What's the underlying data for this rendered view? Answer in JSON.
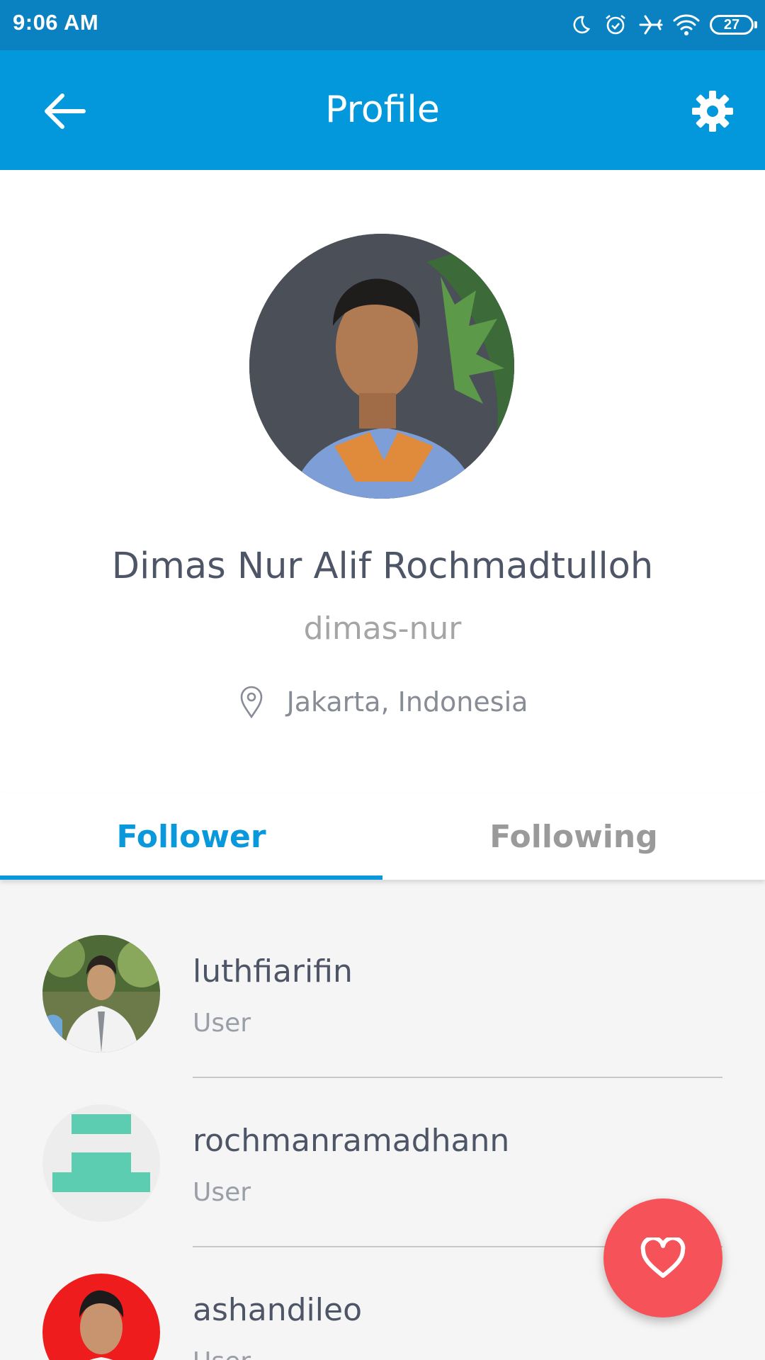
{
  "status_bar": {
    "time": "9:06 AM",
    "battery": "27",
    "icons": [
      "moon-icon",
      "alarm-icon",
      "airplane-icon",
      "wifi-icon",
      "battery-icon"
    ]
  },
  "app_bar": {
    "title": "Profile",
    "back_icon": "arrow-left-icon",
    "settings_icon": "gear-icon",
    "background": "#0398dc"
  },
  "profile": {
    "name": "Dimas Nur Alif Rochmadtulloh",
    "username": "dimas-nur",
    "location": "Jakarta, Indonesia"
  },
  "tabs": [
    {
      "label": "Follower",
      "active": true
    },
    {
      "label": "Following",
      "active": false
    }
  ],
  "accent_color": "#0a98dc",
  "followers": [
    {
      "name": "luthfiarifin",
      "role": "User",
      "avatar": "photo"
    },
    {
      "name": "rochmanramadhann",
      "role": "User",
      "avatar": "identicon"
    },
    {
      "name": "ashandileo",
      "role": "User",
      "avatar": "photo"
    }
  ],
  "fab": {
    "icon": "heart-icon",
    "color": "#f5525a"
  }
}
